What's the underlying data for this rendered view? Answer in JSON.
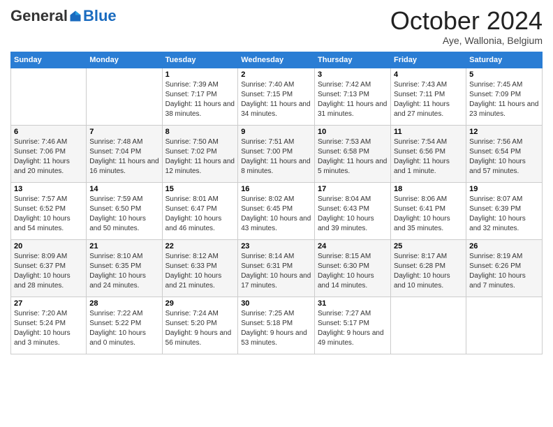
{
  "logo": {
    "general": "General",
    "blue": "Blue"
  },
  "header": {
    "month": "October 2024",
    "location": "Aye, Wallonia, Belgium"
  },
  "weekdays": [
    "Sunday",
    "Monday",
    "Tuesday",
    "Wednesday",
    "Thursday",
    "Friday",
    "Saturday"
  ],
  "weeks": [
    [
      {
        "day": "",
        "sunrise": "",
        "sunset": "",
        "daylight": ""
      },
      {
        "day": "",
        "sunrise": "",
        "sunset": "",
        "daylight": ""
      },
      {
        "day": "1",
        "sunrise": "Sunrise: 7:39 AM",
        "sunset": "Sunset: 7:17 PM",
        "daylight": "Daylight: 11 hours and 38 minutes."
      },
      {
        "day": "2",
        "sunrise": "Sunrise: 7:40 AM",
        "sunset": "Sunset: 7:15 PM",
        "daylight": "Daylight: 11 hours and 34 minutes."
      },
      {
        "day": "3",
        "sunrise": "Sunrise: 7:42 AM",
        "sunset": "Sunset: 7:13 PM",
        "daylight": "Daylight: 11 hours and 31 minutes."
      },
      {
        "day": "4",
        "sunrise": "Sunrise: 7:43 AM",
        "sunset": "Sunset: 7:11 PM",
        "daylight": "Daylight: 11 hours and 27 minutes."
      },
      {
        "day": "5",
        "sunrise": "Sunrise: 7:45 AM",
        "sunset": "Sunset: 7:09 PM",
        "daylight": "Daylight: 11 hours and 23 minutes."
      }
    ],
    [
      {
        "day": "6",
        "sunrise": "Sunrise: 7:46 AM",
        "sunset": "Sunset: 7:06 PM",
        "daylight": "Daylight: 11 hours and 20 minutes."
      },
      {
        "day": "7",
        "sunrise": "Sunrise: 7:48 AM",
        "sunset": "Sunset: 7:04 PM",
        "daylight": "Daylight: 11 hours and 16 minutes."
      },
      {
        "day": "8",
        "sunrise": "Sunrise: 7:50 AM",
        "sunset": "Sunset: 7:02 PM",
        "daylight": "Daylight: 11 hours and 12 minutes."
      },
      {
        "day": "9",
        "sunrise": "Sunrise: 7:51 AM",
        "sunset": "Sunset: 7:00 PM",
        "daylight": "Daylight: 11 hours and 8 minutes."
      },
      {
        "day": "10",
        "sunrise": "Sunrise: 7:53 AM",
        "sunset": "Sunset: 6:58 PM",
        "daylight": "Daylight: 11 hours and 5 minutes."
      },
      {
        "day": "11",
        "sunrise": "Sunrise: 7:54 AM",
        "sunset": "Sunset: 6:56 PM",
        "daylight": "Daylight: 11 hours and 1 minute."
      },
      {
        "day": "12",
        "sunrise": "Sunrise: 7:56 AM",
        "sunset": "Sunset: 6:54 PM",
        "daylight": "Daylight: 10 hours and 57 minutes."
      }
    ],
    [
      {
        "day": "13",
        "sunrise": "Sunrise: 7:57 AM",
        "sunset": "Sunset: 6:52 PM",
        "daylight": "Daylight: 10 hours and 54 minutes."
      },
      {
        "day": "14",
        "sunrise": "Sunrise: 7:59 AM",
        "sunset": "Sunset: 6:50 PM",
        "daylight": "Daylight: 10 hours and 50 minutes."
      },
      {
        "day": "15",
        "sunrise": "Sunrise: 8:01 AM",
        "sunset": "Sunset: 6:47 PM",
        "daylight": "Daylight: 10 hours and 46 minutes."
      },
      {
        "day": "16",
        "sunrise": "Sunrise: 8:02 AM",
        "sunset": "Sunset: 6:45 PM",
        "daylight": "Daylight: 10 hours and 43 minutes."
      },
      {
        "day": "17",
        "sunrise": "Sunrise: 8:04 AM",
        "sunset": "Sunset: 6:43 PM",
        "daylight": "Daylight: 10 hours and 39 minutes."
      },
      {
        "day": "18",
        "sunrise": "Sunrise: 8:06 AM",
        "sunset": "Sunset: 6:41 PM",
        "daylight": "Daylight: 10 hours and 35 minutes."
      },
      {
        "day": "19",
        "sunrise": "Sunrise: 8:07 AM",
        "sunset": "Sunset: 6:39 PM",
        "daylight": "Daylight: 10 hours and 32 minutes."
      }
    ],
    [
      {
        "day": "20",
        "sunrise": "Sunrise: 8:09 AM",
        "sunset": "Sunset: 6:37 PM",
        "daylight": "Daylight: 10 hours and 28 minutes."
      },
      {
        "day": "21",
        "sunrise": "Sunrise: 8:10 AM",
        "sunset": "Sunset: 6:35 PM",
        "daylight": "Daylight: 10 hours and 24 minutes."
      },
      {
        "day": "22",
        "sunrise": "Sunrise: 8:12 AM",
        "sunset": "Sunset: 6:33 PM",
        "daylight": "Daylight: 10 hours and 21 minutes."
      },
      {
        "day": "23",
        "sunrise": "Sunrise: 8:14 AM",
        "sunset": "Sunset: 6:31 PM",
        "daylight": "Daylight: 10 hours and 17 minutes."
      },
      {
        "day": "24",
        "sunrise": "Sunrise: 8:15 AM",
        "sunset": "Sunset: 6:30 PM",
        "daylight": "Daylight: 10 hours and 14 minutes."
      },
      {
        "day": "25",
        "sunrise": "Sunrise: 8:17 AM",
        "sunset": "Sunset: 6:28 PM",
        "daylight": "Daylight: 10 hours and 10 minutes."
      },
      {
        "day": "26",
        "sunrise": "Sunrise: 8:19 AM",
        "sunset": "Sunset: 6:26 PM",
        "daylight": "Daylight: 10 hours and 7 minutes."
      }
    ],
    [
      {
        "day": "27",
        "sunrise": "Sunrise: 7:20 AM",
        "sunset": "Sunset: 5:24 PM",
        "daylight": "Daylight: 10 hours and 3 minutes."
      },
      {
        "day": "28",
        "sunrise": "Sunrise: 7:22 AM",
        "sunset": "Sunset: 5:22 PM",
        "daylight": "Daylight: 10 hours and 0 minutes."
      },
      {
        "day": "29",
        "sunrise": "Sunrise: 7:24 AM",
        "sunset": "Sunset: 5:20 PM",
        "daylight": "Daylight: 9 hours and 56 minutes."
      },
      {
        "day": "30",
        "sunrise": "Sunrise: 7:25 AM",
        "sunset": "Sunset: 5:18 PM",
        "daylight": "Daylight: 9 hours and 53 minutes."
      },
      {
        "day": "31",
        "sunrise": "Sunrise: 7:27 AM",
        "sunset": "Sunset: 5:17 PM",
        "daylight": "Daylight: 9 hours and 49 minutes."
      },
      {
        "day": "",
        "sunrise": "",
        "sunset": "",
        "daylight": ""
      },
      {
        "day": "",
        "sunrise": "",
        "sunset": "",
        "daylight": ""
      }
    ]
  ]
}
